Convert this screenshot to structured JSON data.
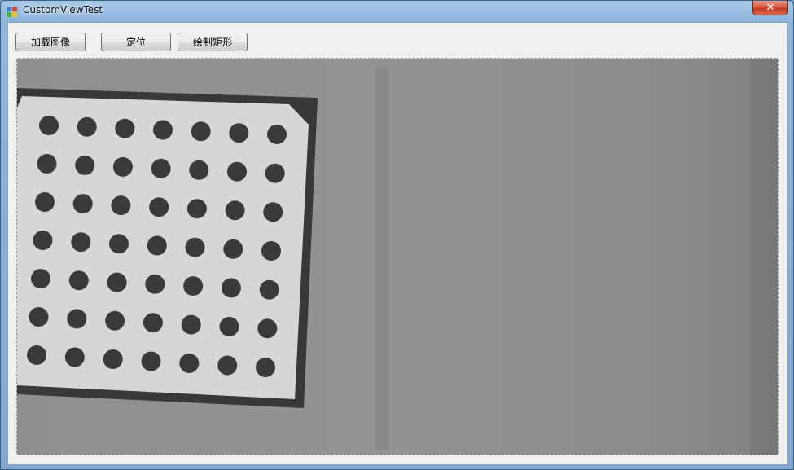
{
  "window": {
    "title": "CustomViewTest",
    "close_glyph": "✕"
  },
  "toolbar": {
    "load_image_label": "加载图像",
    "locate_label": "定位",
    "draw_rect_label": "绘制矩形"
  },
  "viewer": {
    "target_grid": {
      "rows": 7,
      "cols": 7
    }
  },
  "colors": {
    "dots": "#3a3a3a",
    "frame": "#383838",
    "card": "#d6d6d6",
    "background": "#8d8d8d"
  }
}
